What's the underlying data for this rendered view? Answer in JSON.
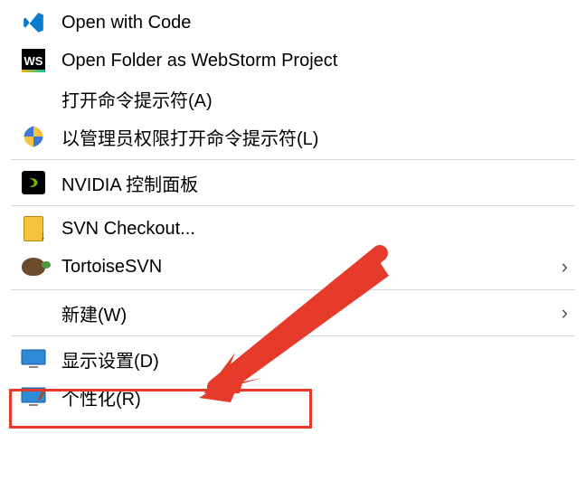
{
  "menu": {
    "items": [
      {
        "id": "open-with-code",
        "label": "Open with Code",
        "icon": "vscode-icon",
        "hasSubmenu": false
      },
      {
        "id": "open-folder-webstorm",
        "label": "Open Folder as WebStorm Project",
        "icon": "webstorm-icon",
        "hasSubmenu": false
      },
      {
        "id": "open-cmd",
        "label": "打开命令提示符(A)",
        "icon": null,
        "hasSubmenu": false
      },
      {
        "id": "open-cmd-admin",
        "label": "以管理员权限打开命令提示符(L)",
        "icon": "shield-icon",
        "hasSubmenu": false
      },
      {
        "separator": true
      },
      {
        "id": "nvidia-control-panel",
        "label": "NVIDIA 控制面板",
        "icon": "nvidia-icon",
        "hasSubmenu": false
      },
      {
        "separator": true
      },
      {
        "id": "svn-checkout",
        "label": "SVN Checkout...",
        "icon": "svn-checkout-icon",
        "hasSubmenu": false
      },
      {
        "id": "tortoisesvn",
        "label": "TortoiseSVN",
        "icon": "tortoisesvn-icon",
        "hasSubmenu": true
      },
      {
        "separator": true
      },
      {
        "id": "new",
        "label": "新建(W)",
        "icon": null,
        "hasSubmenu": true
      },
      {
        "separator": true
      },
      {
        "id": "display-settings",
        "label": "显示设置(D)",
        "icon": "monitor-icon",
        "hasSubmenu": false,
        "highlighted": true
      },
      {
        "id": "personalize",
        "label": "个性化(R)",
        "icon": "personalize-icon",
        "hasSubmenu": false
      }
    ]
  },
  "annotation": {
    "arrow_color": "#e63a2a",
    "highlight_color": "#e63a2a"
  }
}
